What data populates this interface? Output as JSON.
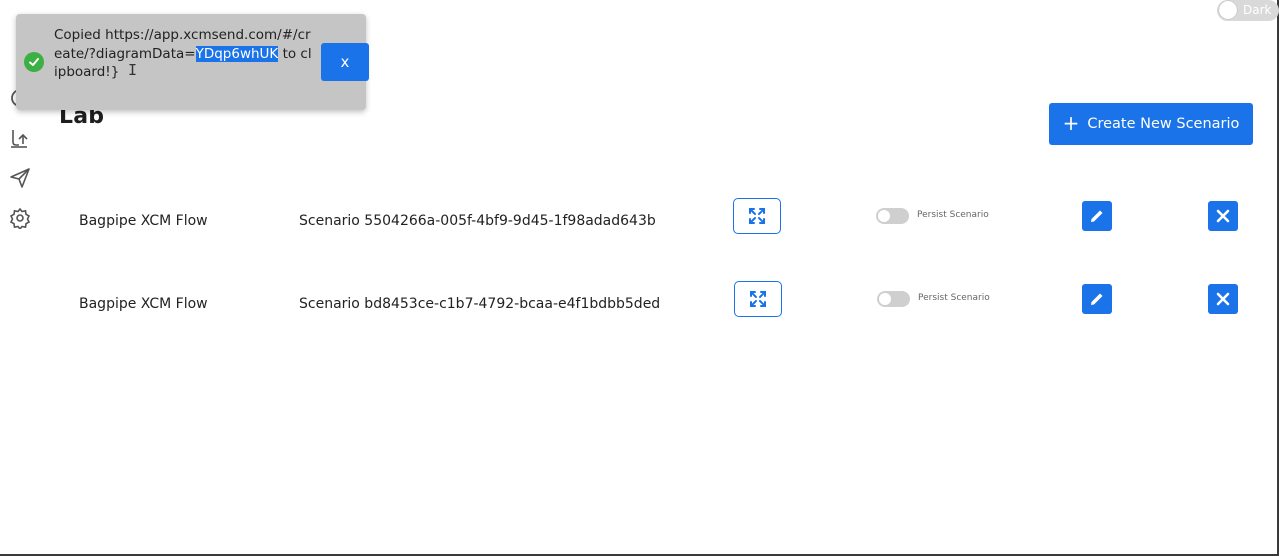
{
  "theme_toggle": {
    "label": "Dark"
  },
  "page": {
    "title": "Lab"
  },
  "actions": {
    "create_label": "Create New Scenario"
  },
  "colors": {
    "accent": "#1a73e8",
    "toast_bg": "#c5c5c5",
    "success": "#3cb043"
  },
  "sidebar": {
    "items": [
      {
        "icon": "dashboard-icon"
      },
      {
        "icon": "lab-icon"
      },
      {
        "icon": "send-icon"
      },
      {
        "icon": "settings-icon"
      }
    ]
  },
  "scenarios": [
    {
      "flow": "Bagpipe XCM Flow",
      "name": "Scenario 5504266a-005f-4bf9-9d45-1f98adad643b",
      "persist_label": "Persist Scenario",
      "persist": false
    },
    {
      "flow": "Bagpipe XCM Flow",
      "name": "Scenario bd8453ce-c1b7-4792-bcaa-e4f1bdbb5ded",
      "persist_label": "Persist Scenario",
      "persist": false
    }
  ],
  "toast": {
    "prefix": "Copied https://app.xcmsend.com/#/create/?diagramData=",
    "selected": "YDqp6whUK",
    "suffix": " to clipboard!}",
    "close_label": "x"
  }
}
